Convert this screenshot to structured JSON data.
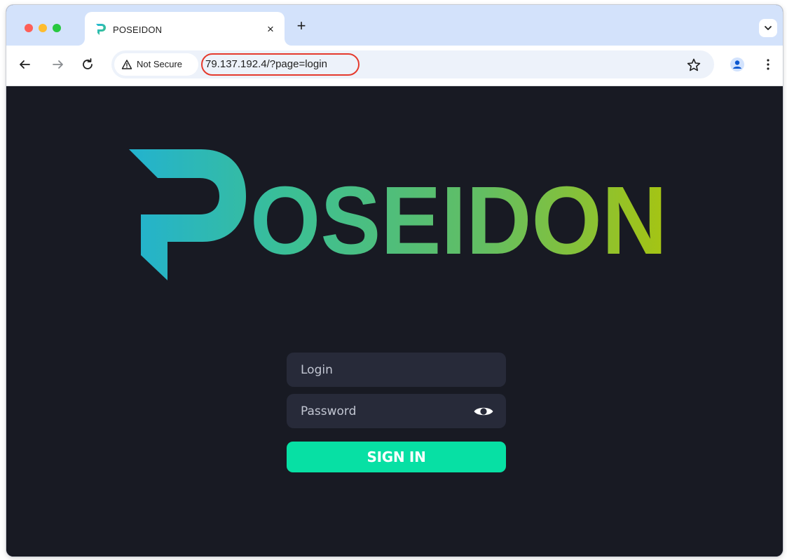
{
  "browser": {
    "tab": {
      "title": "POSEIDON",
      "close_label": "×"
    },
    "new_tab_label": "+",
    "address_bar": {
      "security_label": "Not Secure",
      "url": "79.137.192.4/?page=login",
      "annotation_color": "#e53a2d"
    },
    "icons": {
      "back": "arrow-left-icon",
      "forward": "arrow-right-icon",
      "reload": "reload-icon",
      "warning": "warning-triangle-icon",
      "bookmark": "star-icon",
      "profile": "person-icon",
      "menu": "kebab-menu-icon",
      "tab_search": "chevron-down-icon"
    }
  },
  "page": {
    "logo": {
      "text": "OSEIDON",
      "gradient_start": "#22b2d0",
      "gradient_end": "#a8c410"
    },
    "login_form": {
      "login_placeholder": "Login",
      "password_placeholder": "Password",
      "submit_label": "SIGN IN",
      "button_color": "#07e0a4",
      "field_color": "#272a39",
      "background_color": "#181a23"
    }
  }
}
